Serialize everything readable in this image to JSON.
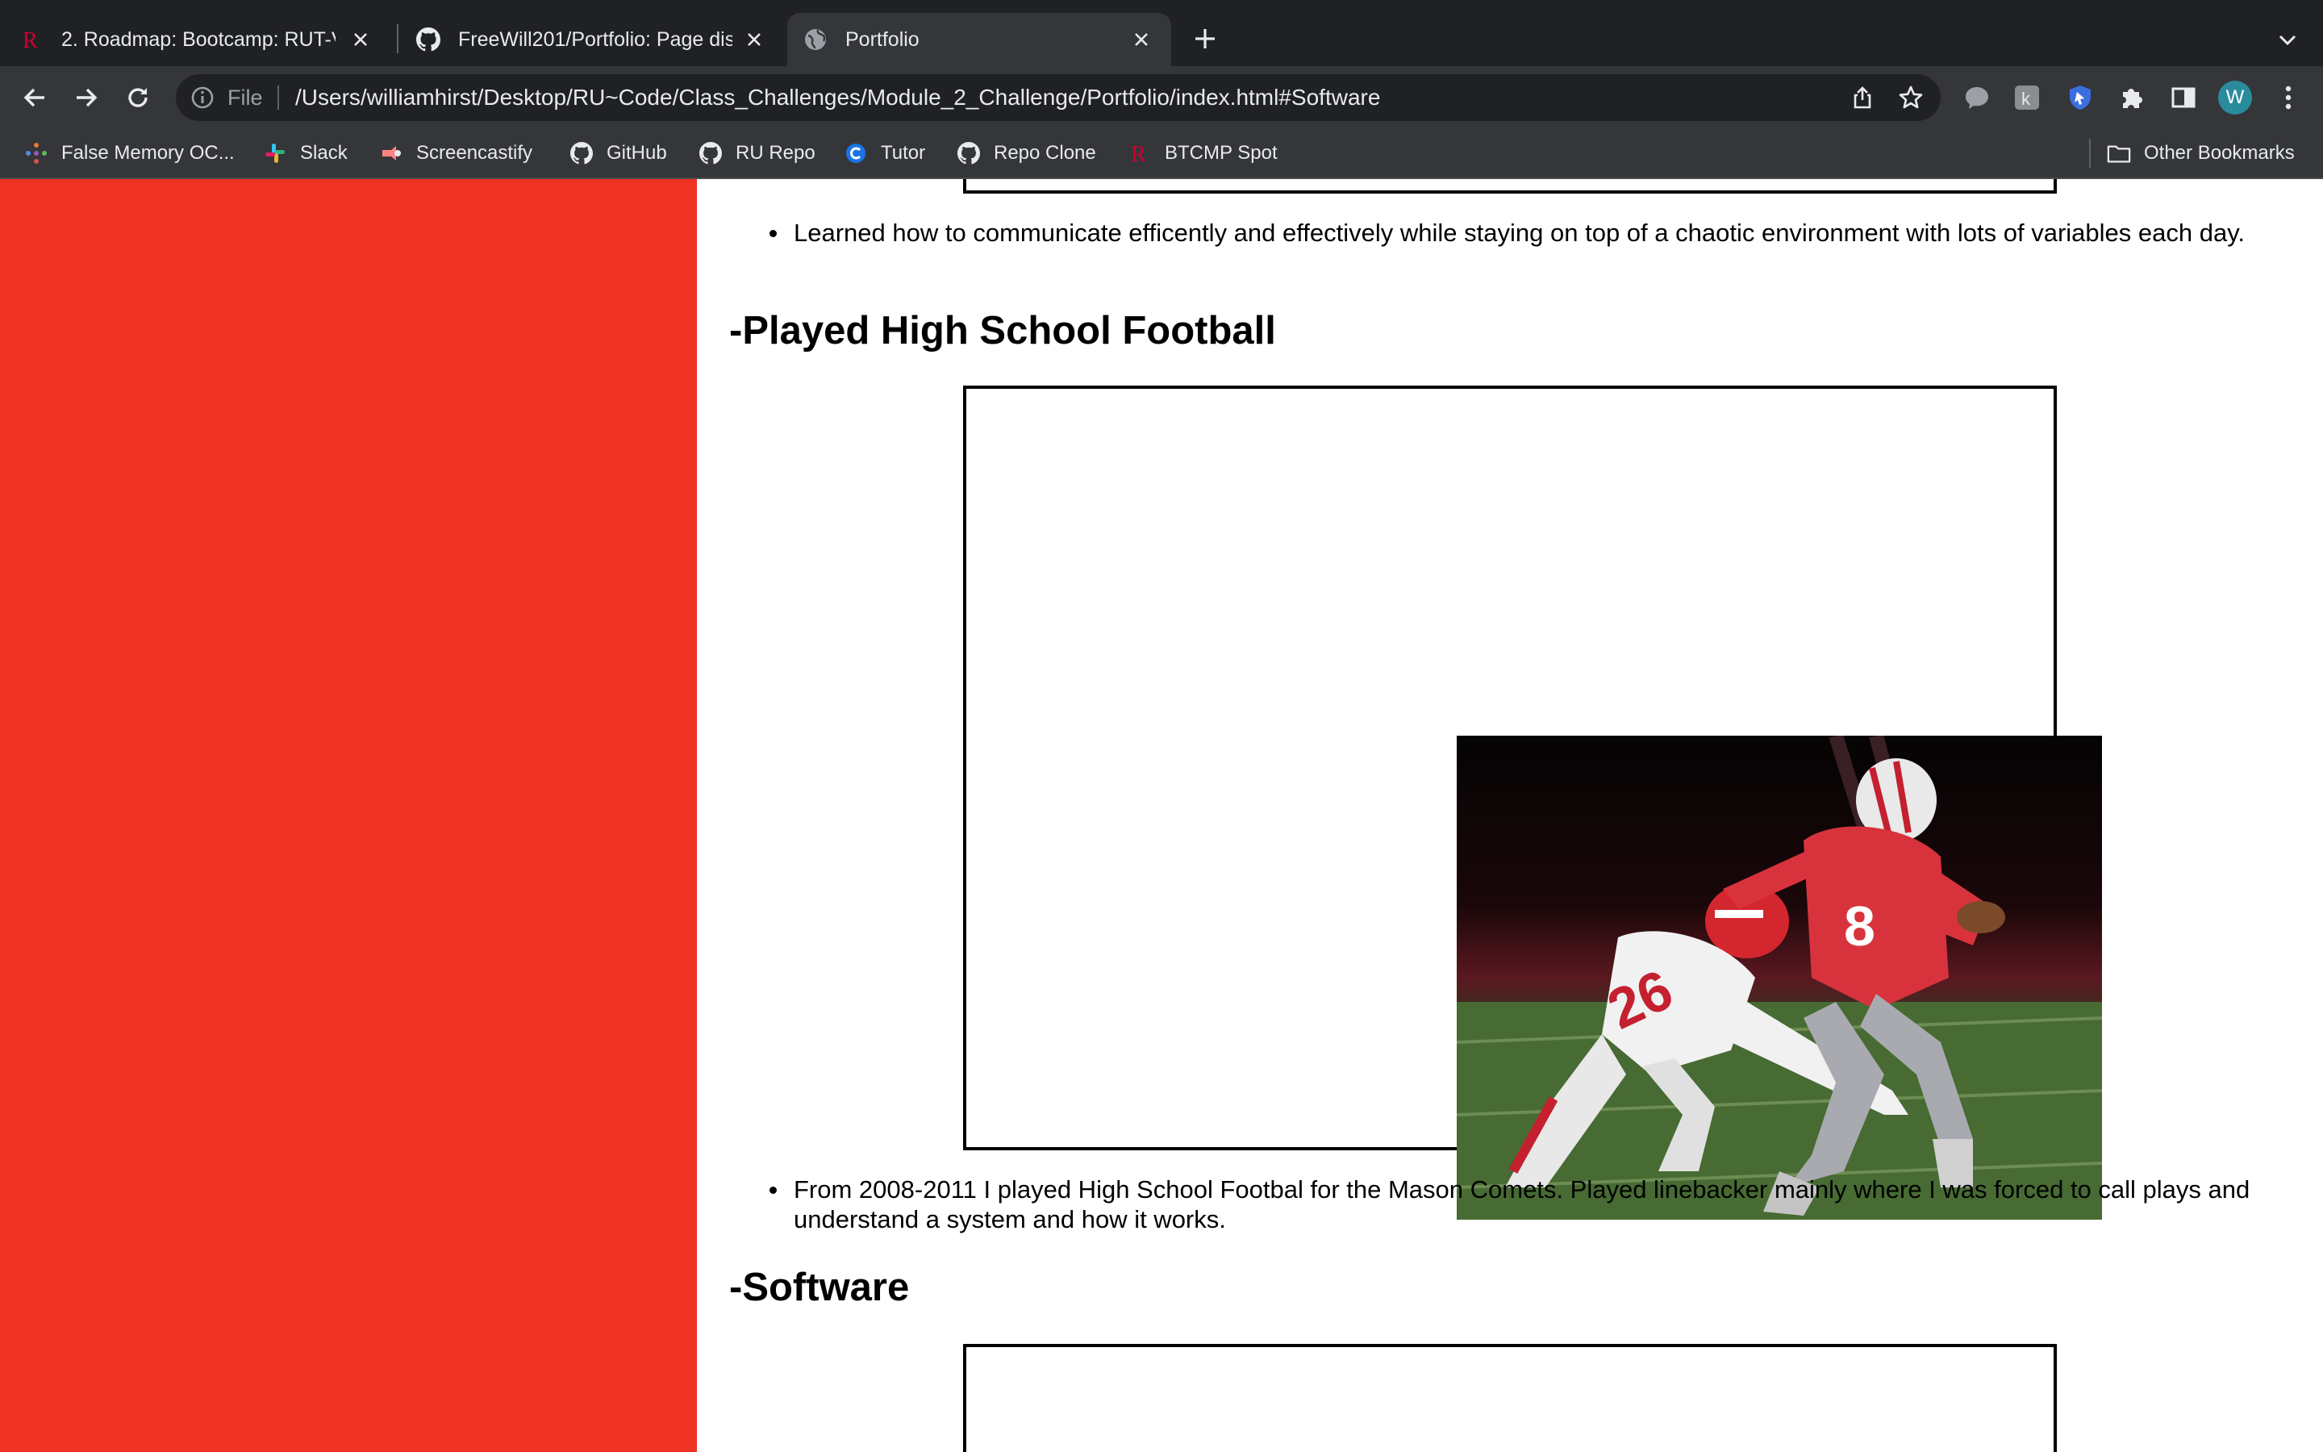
{
  "browser": {
    "tabs": [
      {
        "title": "2. Roadmap: Bootcamp: RUT-V",
        "favicon": "rutgers-r-icon"
      },
      {
        "title": "FreeWill201/Portfolio: Page disp",
        "favicon": "github-icon"
      },
      {
        "title": "Portfolio",
        "favicon": "globe-icon",
        "active": true
      }
    ],
    "omnibox": {
      "scheme_label": "File",
      "url": "/Users/williamhirst/Desktop/RU~Code/Class_Challenges/Module_2_Challenge/Portfolio/index.html#Software"
    },
    "profile_initial": "W",
    "bookmarks": [
      {
        "label": "False Memory OC...",
        "icon": "dots-icon"
      },
      {
        "label": "Slack",
        "icon": "slack-icon"
      },
      {
        "label": "Screencastify",
        "icon": "screencastify-icon"
      },
      {
        "label": "GitHub",
        "icon": "github-icon"
      },
      {
        "label": "RU Repo",
        "icon": "github-icon"
      },
      {
        "label": "Tutor",
        "icon": "tutor-icon"
      },
      {
        "label": "Repo Clone",
        "icon": "github-icon"
      },
      {
        "label": "BTCMP Spot",
        "icon": "rutgers-r-icon"
      }
    ],
    "other_bookmarks": "Other Bookmarks"
  },
  "page": {
    "bullet_1": "Learned how to communicate efficently and effectively while staying on top of a chaotic environment with lots of variables each day.",
    "heading_football": "-Played High School Football",
    "bullet_2": "From 2008-2011 I played High School Footbal for the Mason Comets. Played linebacker mainly where I was forced to call plays and understand a system and how it works.",
    "heading_software": "-Software"
  },
  "colors": {
    "sidebar_red": "#ee3224",
    "chrome_dark": "#202124",
    "chrome_toolbar": "#35363a"
  }
}
